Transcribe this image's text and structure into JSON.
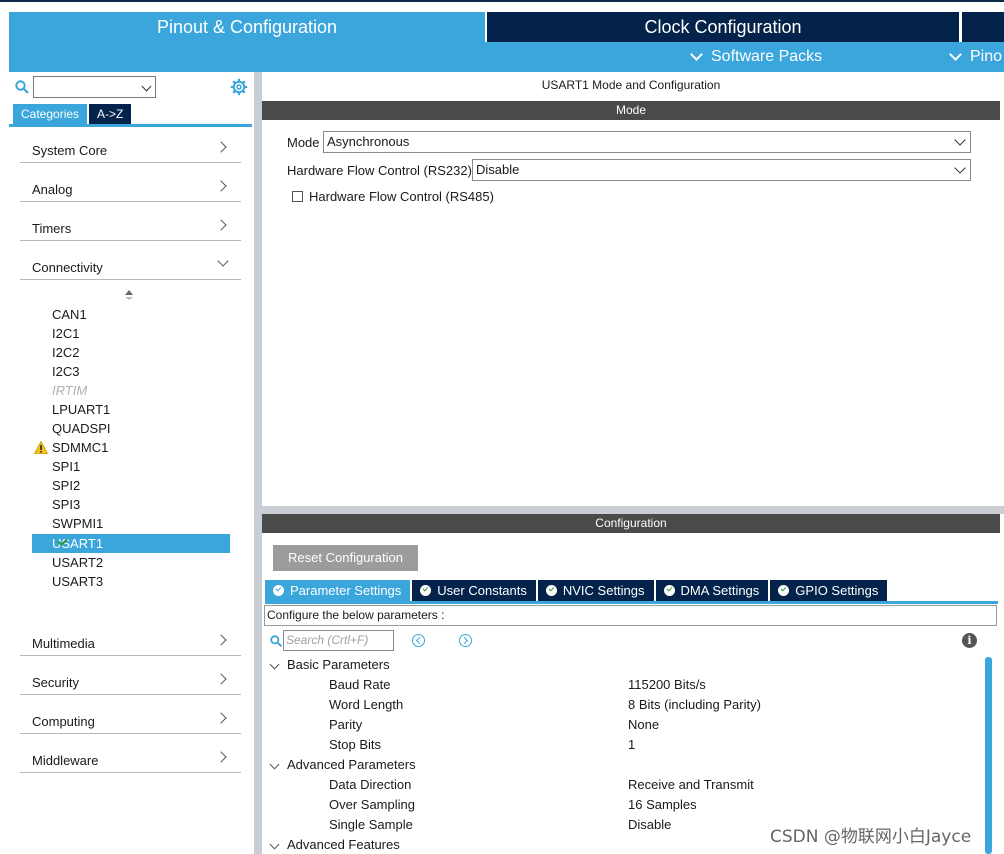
{
  "header": {
    "tabs": [
      {
        "label": "Pinout & Configuration"
      },
      {
        "label": "Clock Configuration"
      }
    ],
    "subbar": {
      "software_packs": "Software Packs",
      "pinout": "Pino"
    }
  },
  "sidebar": {
    "search": {
      "value": "",
      "placeholder": ""
    },
    "view_tabs": [
      {
        "label": "Categories"
      },
      {
        "label": "A->Z"
      }
    ],
    "categories": [
      {
        "label": "System Core"
      },
      {
        "label": "Analog"
      },
      {
        "label": "Timers"
      },
      {
        "label": "Connectivity"
      },
      {
        "label": "Multimedia"
      },
      {
        "label": "Security"
      },
      {
        "label": "Computing"
      },
      {
        "label": "Middleware"
      }
    ],
    "peripherals": [
      {
        "label": "CAN1"
      },
      {
        "label": "I2C1"
      },
      {
        "label": "I2C2"
      },
      {
        "label": "I2C3"
      },
      {
        "label": "IRTIM"
      },
      {
        "label": "LPUART1"
      },
      {
        "label": "QUADSPI"
      },
      {
        "label": "SDMMC1"
      },
      {
        "label": "SPI1"
      },
      {
        "label": "SPI2"
      },
      {
        "label": "SPI3"
      },
      {
        "label": "SWPMI1"
      },
      {
        "label": "USART1"
      },
      {
        "label": "USART2"
      },
      {
        "label": "USART3"
      }
    ]
  },
  "main": {
    "title": "USART1 Mode and Configuration",
    "mode_header": "Mode",
    "mode": {
      "label": "Mode",
      "value": "Asynchronous"
    },
    "hw_flow_rs232": {
      "label": "Hardware Flow Control (RS232)",
      "value": "Disable"
    },
    "hw_flow_rs485": {
      "label": "Hardware Flow Control (RS485)",
      "checked": false
    },
    "config_header": "Configuration",
    "reset_button": "Reset Configuration",
    "config_tabs": [
      {
        "label": "Parameter Settings"
      },
      {
        "label": "User Constants"
      },
      {
        "label": "NVIC Settings"
      },
      {
        "label": "DMA Settings"
      },
      {
        "label": "GPIO Settings"
      }
    ],
    "configure_text": "Configure the below parameters :",
    "search_placeholder": "Search (Crtl+F)",
    "groups": [
      {
        "label": "Basic Parameters",
        "params": [
          {
            "name": "Baud Rate",
            "value": "115200 Bits/s"
          },
          {
            "name": "Word Length",
            "value": "8 Bits (including Parity)"
          },
          {
            "name": "Parity",
            "value": "None"
          },
          {
            "name": "Stop Bits",
            "value": "1"
          }
        ]
      },
      {
        "label": "Advanced Parameters",
        "params": [
          {
            "name": "Data Direction",
            "value": "Receive and Transmit"
          },
          {
            "name": "Over Sampling",
            "value": "16 Samples"
          },
          {
            "name": "Single Sample",
            "value": "Disable"
          }
        ]
      },
      {
        "label": "Advanced Features",
        "params": []
      }
    ]
  },
  "watermark": "CSDN @物联网小白Jayce",
  "colors": {
    "accent": "#3aa6dc",
    "navy": "#03234b",
    "bar": "#4a4a4a"
  }
}
